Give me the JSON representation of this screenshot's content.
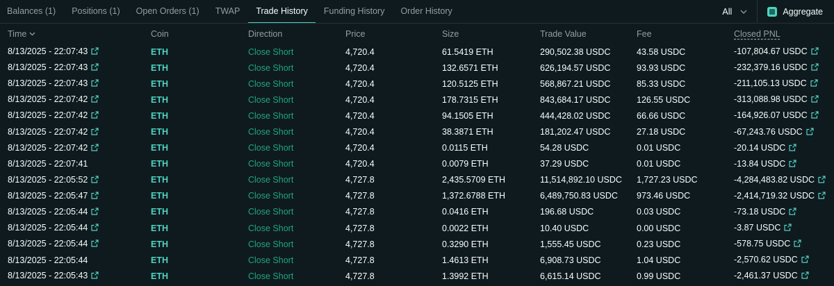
{
  "tabs": [
    {
      "label": "Balances (1)",
      "active": false
    },
    {
      "label": "Positions (1)",
      "active": false
    },
    {
      "label": "Open Orders (1)",
      "active": false
    },
    {
      "label": "TWAP",
      "active": false
    },
    {
      "label": "Trade History",
      "active": true
    },
    {
      "label": "Funding History",
      "active": false
    },
    {
      "label": "Order History",
      "active": false
    }
  ],
  "filter": {
    "selected": "All",
    "icon": "chevron-down-icon"
  },
  "aggregate": {
    "label": "Aggregate",
    "checked": true
  },
  "columns": {
    "time": "Time",
    "coin": "Coin",
    "direction": "Direction",
    "price": "Price",
    "size": "Size",
    "trade_value": "Trade Value",
    "fee": "Fee",
    "closed_pnl": "Closed PNL"
  },
  "colors": {
    "accent": "#50d2c1",
    "direction_green": "#1fa67d",
    "background": "#0f1a1f",
    "muted": "#949e9c"
  },
  "rows": [
    {
      "time": "8/13/2025 - 22:07:43",
      "time_link": true,
      "coin": "ETH",
      "direction": "Close Short",
      "price": "4,720.4",
      "size": "61.5419 ETH",
      "trade_value": "290,502.38 USDC",
      "fee": "43.58 USDC",
      "closed_pnl": "-107,804.67 USDC"
    },
    {
      "time": "8/13/2025 - 22:07:43",
      "time_link": true,
      "coin": "ETH",
      "direction": "Close Short",
      "price": "4,720.4",
      "size": "132.6571 ETH",
      "trade_value": "626,194.57 USDC",
      "fee": "93.93 USDC",
      "closed_pnl": "-232,379.16 USDC"
    },
    {
      "time": "8/13/2025 - 22:07:43",
      "time_link": true,
      "coin": "ETH",
      "direction": "Close Short",
      "price": "4,720.4",
      "size": "120.5125 ETH",
      "trade_value": "568,867.21 USDC",
      "fee": "85.33 USDC",
      "closed_pnl": "-211,105.13 USDC"
    },
    {
      "time": "8/13/2025 - 22:07:42",
      "time_link": true,
      "coin": "ETH",
      "direction": "Close Short",
      "price": "4,720.4",
      "size": "178.7315 ETH",
      "trade_value": "843,684.17 USDC",
      "fee": "126.55 USDC",
      "closed_pnl": "-313,088.98 USDC"
    },
    {
      "time": "8/13/2025 - 22:07:42",
      "time_link": true,
      "coin": "ETH",
      "direction": "Close Short",
      "price": "4,720.4",
      "size": "94.1505 ETH",
      "trade_value": "444,428.02 USDC",
      "fee": "66.66 USDC",
      "closed_pnl": "-164,926.07 USDC"
    },
    {
      "time": "8/13/2025 - 22:07:42",
      "time_link": true,
      "coin": "ETH",
      "direction": "Close Short",
      "price": "4,720.4",
      "size": "38.3871 ETH",
      "trade_value": "181,202.47 USDC",
      "fee": "27.18 USDC",
      "closed_pnl": "-67,243.76 USDC"
    },
    {
      "time": "8/13/2025 - 22:07:42",
      "time_link": true,
      "coin": "ETH",
      "direction": "Close Short",
      "price": "4,720.4",
      "size": "0.0115 ETH",
      "trade_value": "54.28 USDC",
      "fee": "0.01 USDC",
      "closed_pnl": "-20.14 USDC"
    },
    {
      "time": "8/13/2025 - 22:07:41",
      "time_link": false,
      "coin": "ETH",
      "direction": "Close Short",
      "price": "4,720.4",
      "size": "0.0079 ETH",
      "trade_value": "37.29 USDC",
      "fee": "0.01 USDC",
      "closed_pnl": "-13.84 USDC"
    },
    {
      "time": "8/13/2025 - 22:05:52",
      "time_link": true,
      "coin": "ETH",
      "direction": "Close Short",
      "price": "4,727.8",
      "size": "2,435.5709 ETH",
      "trade_value": "11,514,892.10 USDC",
      "fee": "1,727.23 USDC",
      "closed_pnl": "-4,284,483.82 USDC"
    },
    {
      "time": "8/13/2025 - 22:05:47",
      "time_link": true,
      "coin": "ETH",
      "direction": "Close Short",
      "price": "4,727.8",
      "size": "1,372.6788 ETH",
      "trade_value": "6,489,750.83 USDC",
      "fee": "973.46 USDC",
      "closed_pnl": "-2,414,719.32 USDC"
    },
    {
      "time": "8/13/2025 - 22:05:44",
      "time_link": true,
      "coin": "ETH",
      "direction": "Close Short",
      "price": "4,727.8",
      "size": "0.0416 ETH",
      "trade_value": "196.68 USDC",
      "fee": "0.03 USDC",
      "closed_pnl": "-73.18 USDC"
    },
    {
      "time": "8/13/2025 - 22:05:44",
      "time_link": true,
      "coin": "ETH",
      "direction": "Close Short",
      "price": "4,727.8",
      "size": "0.0022 ETH",
      "trade_value": "10.40 USDC",
      "fee": "0.00 USDC",
      "closed_pnl": "-3.87 USDC"
    },
    {
      "time": "8/13/2025 - 22:05:44",
      "time_link": true,
      "coin": "ETH",
      "direction": "Close Short",
      "price": "4,727.8",
      "size": "0.3290 ETH",
      "trade_value": "1,555.45 USDC",
      "fee": "0.23 USDC",
      "closed_pnl": "-578.75 USDC"
    },
    {
      "time": "8/13/2025 - 22:05:44",
      "time_link": false,
      "coin": "ETH",
      "direction": "Close Short",
      "price": "4,727.8",
      "size": "1.4613 ETH",
      "trade_value": "6,908.73 USDC",
      "fee": "1.04 USDC",
      "closed_pnl": "-2,570.62 USDC"
    },
    {
      "time": "8/13/2025 - 22:05:43",
      "time_link": true,
      "coin": "ETH",
      "direction": "Close Short",
      "price": "4,727.8",
      "size": "1.3992 ETH",
      "trade_value": "6,615.14 USDC",
      "fee": "0.99 USDC",
      "closed_pnl": "-2,461.37 USDC"
    }
  ]
}
